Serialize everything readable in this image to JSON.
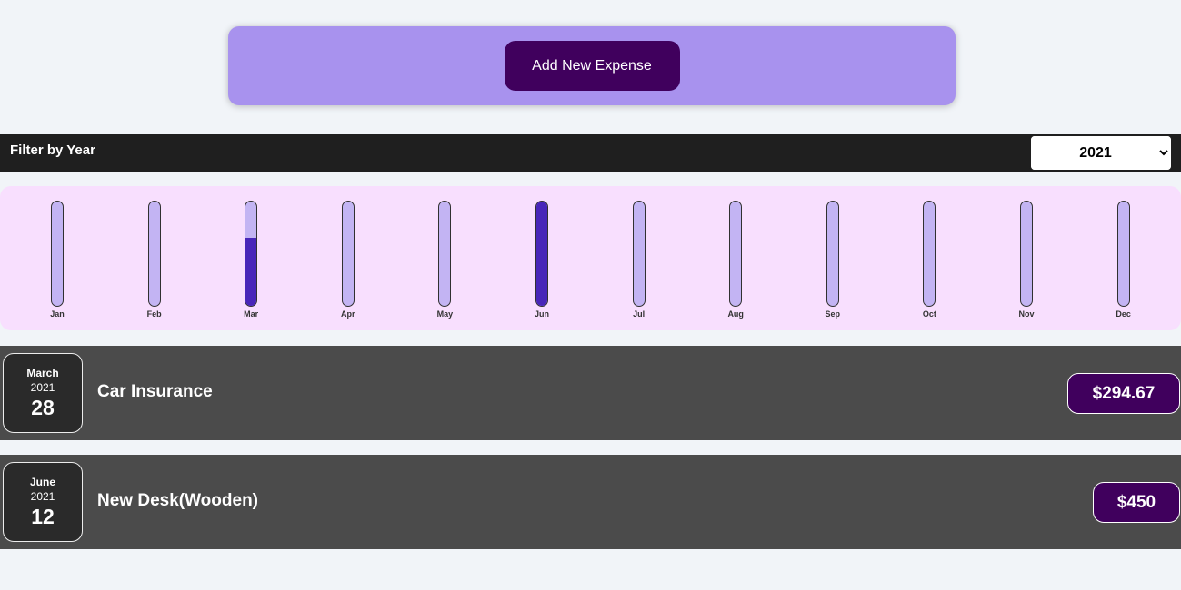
{
  "new_expense": {
    "add_button_label": "Add New Expense"
  },
  "filter": {
    "label": "Filter by Year",
    "selected_year": "2021",
    "options": [
      "2021"
    ]
  },
  "chart_data": {
    "type": "bar",
    "categories": [
      "Jan",
      "Feb",
      "Mar",
      "Apr",
      "May",
      "Jun",
      "Jul",
      "Aug",
      "Sep",
      "Oct",
      "Nov",
      "Dec"
    ],
    "values": [
      0,
      0,
      294.67,
      0,
      0,
      450,
      0,
      0,
      0,
      0,
      0,
      0
    ],
    "max": 450,
    "colors": {
      "track": "#c3b4f3",
      "fill": "#4826b9",
      "background": "#f8dffe"
    }
  },
  "expenses": [
    {
      "month": "March",
      "year": "2021",
      "day": "28",
      "title": "Car Insurance",
      "amount": "$294.67"
    },
    {
      "month": "June",
      "year": "2021",
      "day": "12",
      "title": "New Desk(Wooden)",
      "amount": "$450"
    }
  ],
  "colors": {
    "accent": "#40005d",
    "panel": "#a892ee",
    "item_bg": "#4b4b4b",
    "filter_bg": "#1f1f1f"
  }
}
